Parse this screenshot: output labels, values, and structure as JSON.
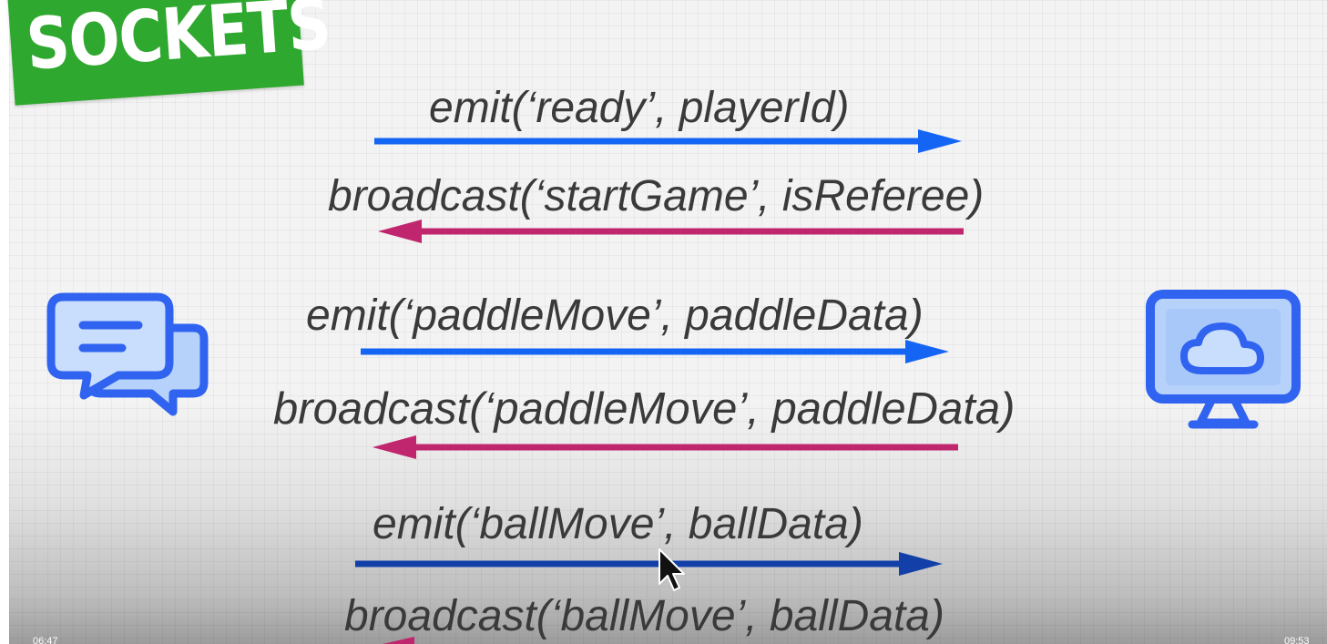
{
  "title": "SOCKETS",
  "messages": [
    {
      "label": "emit(‘ready’, playerId)",
      "direction": "right",
      "color": "#1565f5"
    },
    {
      "label": "broadcast(‘startGame’, isReferee)",
      "direction": "left",
      "color": "#c0266d"
    },
    {
      "label": "emit(‘paddleMove’, paddleData)",
      "direction": "right",
      "color": "#1565f5"
    },
    {
      "label": "broadcast(‘paddleMove’, paddleData)",
      "direction": "left",
      "color": "#c0266d"
    },
    {
      "label": "emit(‘ballMove’, ballData)",
      "direction": "right",
      "color": "#1240a8"
    },
    {
      "label": "broadcast(‘ballMove’, ballData)",
      "direction": "left",
      "color": "#c0266d"
    }
  ],
  "icons": {
    "client": "chat-bubbles-icon",
    "server": "cloud-monitor-icon"
  },
  "colors": {
    "banner": "#2fa82f",
    "icon_stroke": "#2f63f0",
    "icon_fill": "#b6d2fb"
  },
  "player": {
    "current_time": "06:47",
    "total_time": "09:53"
  }
}
